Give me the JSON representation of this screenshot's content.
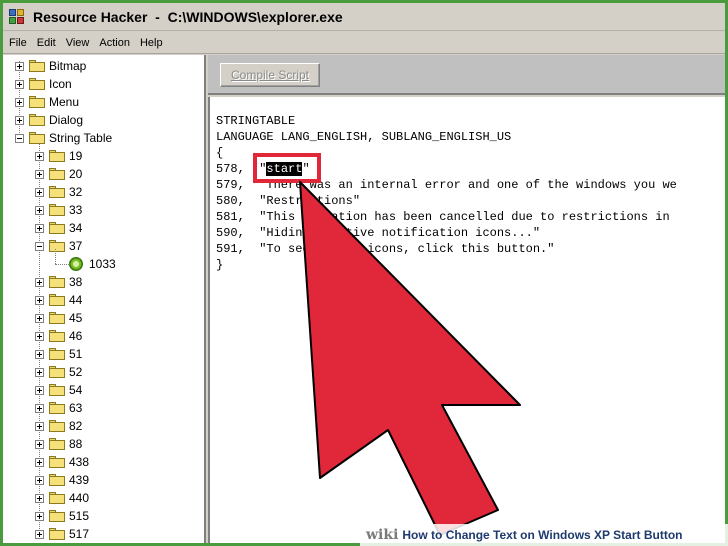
{
  "window": {
    "title": "Resource Hacker  -  C:\\WINDOWS\\explorer.exe"
  },
  "menu": [
    "File",
    "Edit",
    "View",
    "Action",
    "Help"
  ],
  "tree": {
    "top_level": [
      {
        "label": "Bitmap",
        "expander": "plus"
      },
      {
        "label": "Icon",
        "expander": "plus"
      },
      {
        "label": "Menu",
        "expander": "plus"
      },
      {
        "label": "Dialog",
        "expander": "plus"
      },
      {
        "label": "String Table",
        "expander": "minus"
      }
    ],
    "string_table_children": [
      {
        "label": "19",
        "expander": "plus"
      },
      {
        "label": "20",
        "expander": "plus"
      },
      {
        "label": "32",
        "expander": "plus"
      },
      {
        "label": "33",
        "expander": "plus"
      },
      {
        "label": "34",
        "expander": "plus"
      },
      {
        "label": "37",
        "expander": "minus"
      },
      {
        "label": "1033",
        "expander": "none",
        "leaf": true
      },
      {
        "label": "38",
        "expander": "plus"
      },
      {
        "label": "44",
        "expander": "plus"
      },
      {
        "label": "45",
        "expander": "plus"
      },
      {
        "label": "46",
        "expander": "plus"
      },
      {
        "label": "51",
        "expander": "plus"
      },
      {
        "label": "52",
        "expander": "plus"
      },
      {
        "label": "54",
        "expander": "plus"
      },
      {
        "label": "63",
        "expander": "plus"
      },
      {
        "label": "82",
        "expander": "plus"
      },
      {
        "label": "88",
        "expander": "plus"
      },
      {
        "label": "438",
        "expander": "plus"
      },
      {
        "label": "439",
        "expander": "plus"
      },
      {
        "label": "440",
        "expander": "plus"
      },
      {
        "label": "515",
        "expander": "plus"
      },
      {
        "label": "517",
        "expander": "plus"
      }
    ]
  },
  "toolbar": {
    "compile_label": "Compile Script"
  },
  "editor": {
    "lines": [
      "STRINGTABLE",
      "LANGUAGE LANG_ENGLISH, SUBLANG_ENGLISH_US",
      "{",
      "578,  \"start\"",
      "579,  \"There was an internal error and one of the windows you we",
      "580,  \"Restrictions\"",
      "581,  \"This operation has been cancelled due to restrictions in",
      "590,  \"Hiding inactive notification icons...\"",
      "591,  \"To see hidden icons, click this button.\"",
      "}"
    ],
    "selected_word": "start"
  },
  "caption": {
    "logo": "wiki",
    "text": "How to Change Text on Windows XP Start Button"
  },
  "colors": {
    "arrow": "#e0283a",
    "frame": "#4a9a3e",
    "caption_text": "#1e3a6e"
  },
  "icons": [
    "resource-hacker-app-icon",
    "folder-icon",
    "gear-icon",
    "red-arrow-pointer-icon"
  ]
}
